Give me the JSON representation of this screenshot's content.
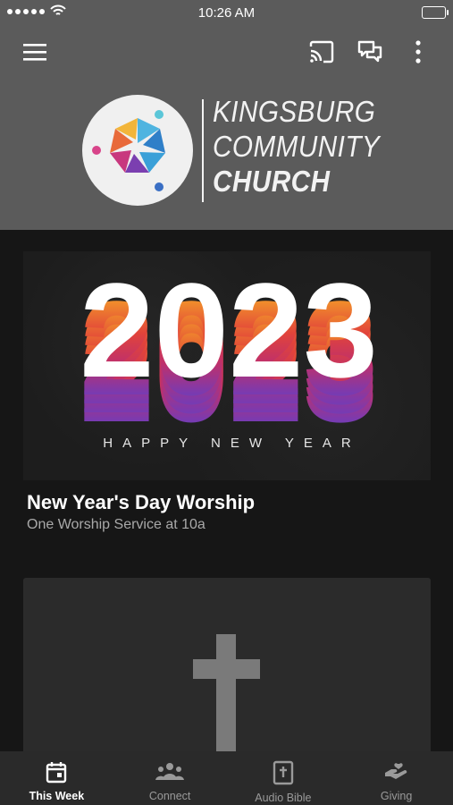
{
  "status_bar": {
    "time": "10:26 AM"
  },
  "header": {
    "church_name_line1": "KINGSBURG",
    "church_name_line2": "COMMUNITY",
    "church_name_line3": "CHURCH"
  },
  "feed": {
    "hero_year": "2023",
    "hero_caption": "HAPPY NEW YEAR",
    "item_title": "New Year's Day Worship",
    "item_subtitle": "One Worship Service at 10a"
  },
  "tabs": [
    {
      "label": "This Week",
      "icon": "calendar-icon",
      "active": true
    },
    {
      "label": "Connect",
      "icon": "people-icon",
      "active": false
    },
    {
      "label": "Audio Bible",
      "icon": "bible-icon",
      "active": false
    },
    {
      "label": "Giving",
      "icon": "giving-hand-icon",
      "active": false
    }
  ],
  "colors": {
    "header_bg": "#5b5b5b",
    "page_bg": "#161616",
    "tab_bar_bg": "#2a2a2a"
  }
}
